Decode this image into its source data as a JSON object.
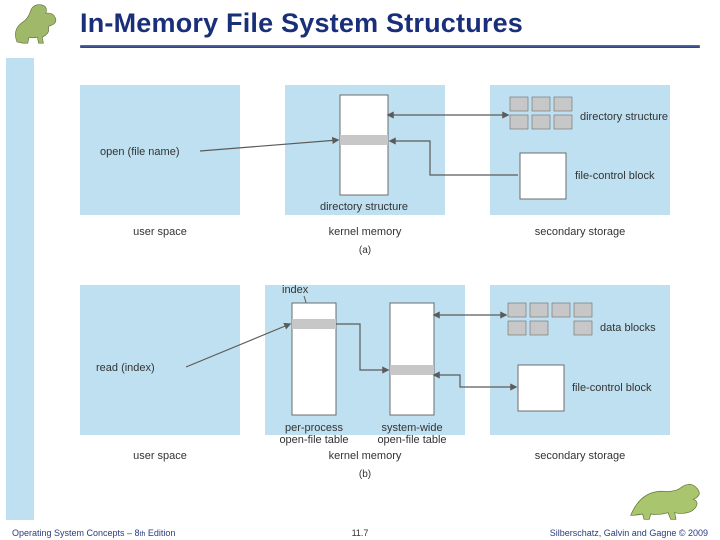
{
  "title": "In-Memory File System Structures",
  "footer": {
    "left_a": "Operating System Concepts – 8",
    "left_b": " Edition",
    "sup": "th",
    "center": "11.7",
    "right": "Silberschatz, Galvin and Gagne © 2009"
  },
  "diagram": {
    "a": {
      "user_call": "open (file name)",
      "kernel_label": "directory structure",
      "right_top": "directory structure",
      "right_bottom": "file-control block",
      "cols": {
        "user": "user space",
        "kernel": "kernel memory",
        "secondary": "secondary storage"
      },
      "caption": "(a)"
    },
    "b": {
      "user_call": "read (index)",
      "index_label": "index",
      "kernel_left": "per-process\nopen-file table",
      "kernel_right": "system-wide\nopen-file table",
      "right_top": "data blocks",
      "right_bottom": "file-control block",
      "cols": {
        "user": "user space",
        "kernel": "kernel memory",
        "secondary": "secondary storage"
      },
      "caption": "(b)"
    }
  }
}
